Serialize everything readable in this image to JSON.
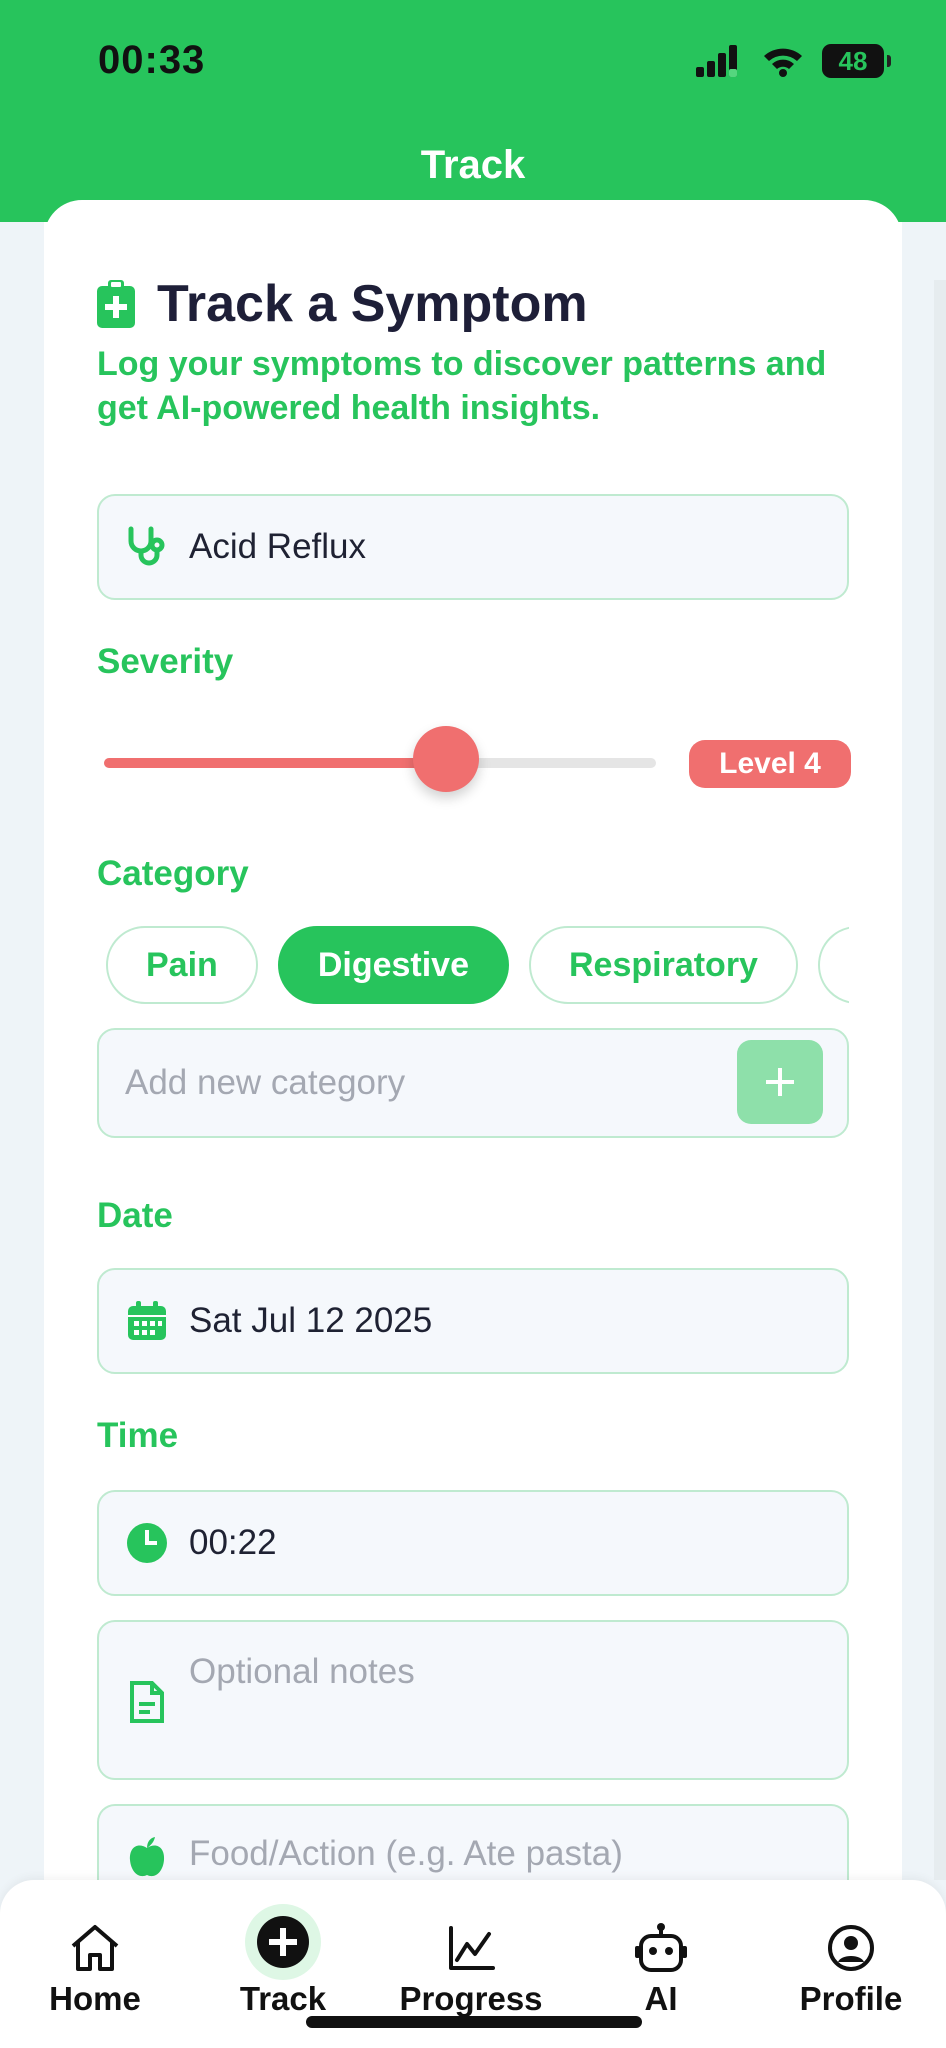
{
  "status_bar": {
    "time": "00:33",
    "battery": "48"
  },
  "nav": {
    "title": "Track"
  },
  "card": {
    "title": "Track a Symptom",
    "subtitle": "Log your symptoms to discover patterns and get AI-powered health insights."
  },
  "symptom": {
    "value": "Acid Reflux",
    "icon": "stethoscope-icon"
  },
  "severity": {
    "label": "Severity",
    "level_text": "Level 4",
    "fraction": 0.62,
    "color": "#f06f6f"
  },
  "category": {
    "label": "Category",
    "chips": [
      "Pain",
      "Digestive",
      "Respiratory"
    ],
    "selected": "Digestive",
    "new_placeholder": "Add new category",
    "add_symbol": "+"
  },
  "date": {
    "label": "Date",
    "value": "Sat Jul 12 2025",
    "icon": "calendar-icon"
  },
  "time": {
    "label": "Time",
    "value": "00:22",
    "icon": "clock-icon"
  },
  "notes": {
    "placeholder": "Optional notes",
    "icon": "note-icon"
  },
  "food": {
    "placeholder": "Food/Action (e.g. Ate pasta)",
    "icon": "apple-icon"
  },
  "tabs": [
    {
      "label": "Home",
      "icon": "home-icon"
    },
    {
      "label": "Track",
      "icon": "add-circle-icon"
    },
    {
      "label": "Progress",
      "icon": "chart-line-icon"
    },
    {
      "label": "AI",
      "icon": "robot-icon"
    },
    {
      "label": "Profile",
      "icon": "user-circle-icon"
    }
  ],
  "colors": {
    "primary": "#27c45c",
    "severity": "#f06f6f",
    "text": "#1e1f38"
  }
}
